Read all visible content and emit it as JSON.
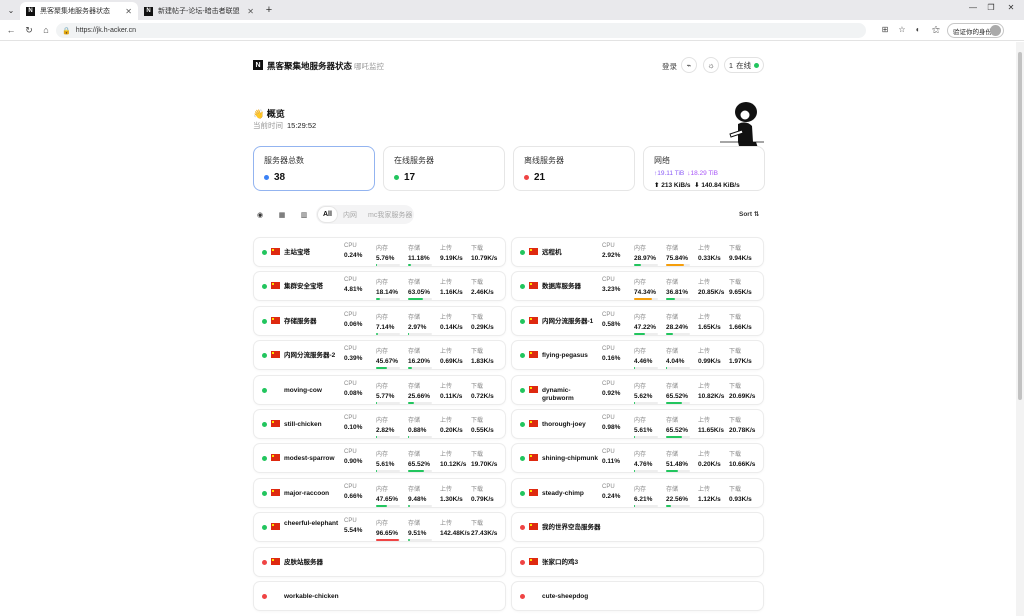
{
  "browser": {
    "tabs": [
      {
        "title": "黑客聚集地服务器状态",
        "icon": "N"
      },
      {
        "title": "新建帖子-论坛-暗击者联盟",
        "icon": "N"
      }
    ],
    "url": "https://jk.h-acker.cn",
    "profile_label": "验证你的身份"
  },
  "header": {
    "logo": "N",
    "title": "黑客聚集地服务器状态",
    "subtitle": "哪吒监控",
    "login": "登录",
    "online_count": "1",
    "online_label": "在线"
  },
  "overview": {
    "title": "👋 概览",
    "time_label": "当前时间",
    "time": "15:29:52"
  },
  "cards": {
    "total": {
      "label": "服务器总数",
      "value": "38",
      "color": "#3b82f6"
    },
    "online": {
      "label": "在线服务器",
      "value": "17",
      "color": "#22c55e"
    },
    "offline": {
      "label": "离线服务器",
      "value": "21",
      "color": "#ef4444"
    },
    "network": {
      "label": "网络",
      "up_total": "↑19.11 TiB",
      "down_total": "↓18.29 TiB",
      "up_speed": "213 KiB/s",
      "down_speed": "140.84 KiB/s"
    }
  },
  "filters": {
    "tabs": [
      "All",
      "内网",
      "mc我家服务器"
    ],
    "sort": "Sort ⇅"
  },
  "labels": {
    "cpu": "CPU",
    "mem": "内存",
    "disk": "存储",
    "up": "上传",
    "down": "下载"
  },
  "servers_left": [
    {
      "name": "主站宝塔",
      "online": true,
      "flag": true,
      "cpu": "0.24%",
      "mem": "5.76%",
      "disk": "11.18%",
      "up": "9.19K/s",
      "down": "10.79K/s",
      "mem_pct": 5.76,
      "disk_pct": 11.18
    },
    {
      "name": "集群安全宝塔",
      "online": true,
      "flag": true,
      "cpu": "4.81%",
      "mem": "18.14%",
      "disk": "63.05%",
      "up": "1.16K/s",
      "down": "2.46K/s",
      "mem_pct": 18.14,
      "disk_pct": 63.05
    },
    {
      "name": "存储服务器",
      "online": true,
      "flag": true,
      "cpu": "0.06%",
      "mem": "7.14%",
      "disk": "2.97%",
      "up": "0.14K/s",
      "down": "0.29K/s",
      "mem_pct": 7.14,
      "disk_pct": 2.97
    },
    {
      "name": "内网分流服务器-2",
      "online": true,
      "flag": true,
      "cpu": "0.39%",
      "mem": "45.67%",
      "disk": "16.20%",
      "up": "0.69K/s",
      "down": "1.83K/s",
      "mem_pct": 45.67,
      "disk_pct": 16.2
    },
    {
      "name": "moving-cow",
      "online": true,
      "flag": false,
      "cpu": "0.08%",
      "mem": "5.77%",
      "disk": "25.66%",
      "up": "0.11K/s",
      "down": "0.72K/s",
      "mem_pct": 5.77,
      "disk_pct": 25.66
    },
    {
      "name": "still-chicken",
      "online": true,
      "flag": true,
      "cpu": "0.10%",
      "mem": "2.82%",
      "disk": "0.88%",
      "up": "0.20K/s",
      "down": "0.55K/s",
      "mem_pct": 2.82,
      "disk_pct": 0.88
    },
    {
      "name": "modest-sparrow",
      "online": true,
      "flag": true,
      "cpu": "0.90%",
      "mem": "5.61%",
      "disk": "65.52%",
      "up": "10.12K/s",
      "down": "19.70K/s",
      "mem_pct": 5.61,
      "disk_pct": 65.52
    },
    {
      "name": "major-raccoon",
      "online": true,
      "flag": true,
      "cpu": "0.66%",
      "mem": "47.65%",
      "disk": "9.48%",
      "up": "1.30K/s",
      "down": "0.79K/s",
      "mem_pct": 47.65,
      "disk_pct": 9.48
    },
    {
      "name": "cheerful-elephant",
      "online": true,
      "flag": true,
      "cpu": "5.54%",
      "mem": "96.65%",
      "disk": "9.51%",
      "up": "142.48K/s",
      "down": "27.43K/s",
      "mem_pct": 96.65,
      "disk_pct": 9.51
    },
    {
      "name": "皮肤站服务器",
      "online": false,
      "flag": true
    },
    {
      "name": "workable-chicken",
      "online": false,
      "flag": false
    }
  ],
  "servers_right": [
    {
      "name": "远程机",
      "online": true,
      "flag": true,
      "cpu": "2.92%",
      "mem": "28.97%",
      "disk": "75.84%",
      "up": "0.33K/s",
      "down": "9.94K/s",
      "mem_pct": 28.97,
      "disk_pct": 75.84
    },
    {
      "name": "数据库服务器",
      "online": true,
      "flag": true,
      "cpu": "3.23%",
      "mem": "74.34%",
      "disk": "36.81%",
      "up": "20.85K/s",
      "down": "9.65K/s",
      "mem_pct": 74.34,
      "disk_pct": 36.81
    },
    {
      "name": "内网分流服务器-1",
      "online": true,
      "flag": true,
      "cpu": "0.58%",
      "mem": "47.22%",
      "disk": "28.24%",
      "up": "1.65K/s",
      "down": "1.66K/s",
      "mem_pct": 47.22,
      "disk_pct": 28.24
    },
    {
      "name": "flying-pegasus",
      "online": true,
      "flag": true,
      "cpu": "0.16%",
      "mem": "4.46%",
      "disk": "4.04%",
      "up": "0.99K/s",
      "down": "1.97K/s",
      "mem_pct": 4.46,
      "disk_pct": 4.04
    },
    {
      "name": "dynamic-grubworm",
      "online": true,
      "flag": true,
      "cpu": "0.92%",
      "mem": "5.62%",
      "disk": "65.52%",
      "up": "10.82K/s",
      "down": "20.69K/s",
      "mem_pct": 5.62,
      "disk_pct": 65.52
    },
    {
      "name": "thorough-joey",
      "online": true,
      "flag": true,
      "cpu": "0.98%",
      "mem": "5.61%",
      "disk": "65.52%",
      "up": "11.65K/s",
      "down": "20.78K/s",
      "mem_pct": 5.61,
      "disk_pct": 65.52
    },
    {
      "name": "shining-chipmunk",
      "online": true,
      "flag": true,
      "cpu": "0.11%",
      "mem": "4.76%",
      "disk": "51.48%",
      "up": "0.20K/s",
      "down": "10.66K/s",
      "mem_pct": 4.76,
      "disk_pct": 51.48
    },
    {
      "name": "steady-chimp",
      "online": true,
      "flag": true,
      "cpu": "0.24%",
      "mem": "6.21%",
      "disk": "22.56%",
      "up": "1.12K/s",
      "down": "0.93K/s",
      "mem_pct": 6.21,
      "disk_pct": 22.56
    },
    {
      "name": "我的世界空岛服务器",
      "online": false,
      "flag": true
    },
    {
      "name": "张家口的鸡3",
      "online": false,
      "flag": true
    },
    {
      "name": "cute-sheepdog",
      "online": false,
      "flag": false
    }
  ],
  "colors": {
    "online": "#22c55e",
    "offline": "#ef4444",
    "warn": "#f59e0b",
    "danger": "#ef4444",
    "bar_ok": "#22c55e"
  }
}
